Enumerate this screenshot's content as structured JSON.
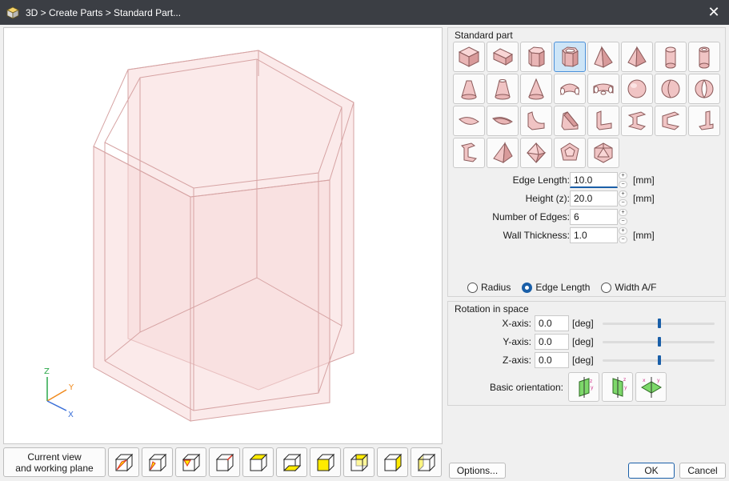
{
  "window": {
    "title": "3D > Create Parts > Standard Part..."
  },
  "viewbar": {
    "current_view_label": "Current view\nand working plane"
  },
  "triad": {
    "x": "X",
    "y": "Y",
    "z": "Z"
  },
  "standard_part": {
    "group_title": "Standard part",
    "params": [
      {
        "label": "Edge Length:",
        "value": "10.0",
        "unit": "[mm]"
      },
      {
        "label": "Height (z):",
        "value": "20.0",
        "unit": "[mm]"
      },
      {
        "label": "Number of Edges:",
        "value": "6",
        "unit": ""
      },
      {
        "label": "Wall Thickness:",
        "value": "1.0",
        "unit": "[mm]"
      }
    ],
    "radio": {
      "radius": "Radius",
      "edge_length": "Edge Length",
      "width_af": "Width A/F",
      "selected": "edge_length"
    }
  },
  "rotation": {
    "group_title": "Rotation in space",
    "axes": [
      {
        "label": "X-axis:",
        "value": "0.0",
        "unit": "[deg]",
        "level": 0.5
      },
      {
        "label": "Y-axis:",
        "value": "0.0",
        "unit": "[deg]",
        "level": 0.5
      },
      {
        "label": "Z-axis:",
        "value": "0.0",
        "unit": "[deg]",
        "level": 0.5
      }
    ],
    "basic_orientation_label": "Basic orientation:"
  },
  "buttons": {
    "options": "Options...",
    "ok": "OK",
    "cancel": "Cancel"
  },
  "colors": {
    "accent": "#1a5fa8",
    "titlebar": "#3b3e44",
    "part_fill": "#f4c9c9",
    "highlight": "#ffeb00"
  }
}
